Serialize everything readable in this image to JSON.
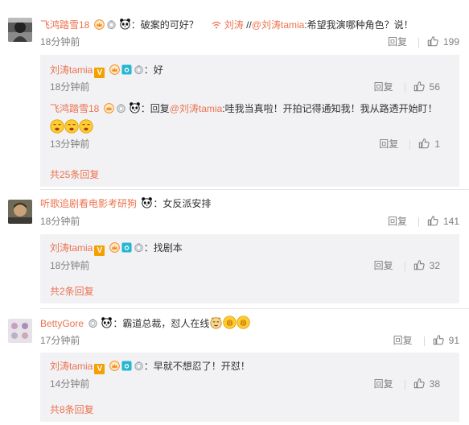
{
  "comments": [
    {
      "user": "飞鸿踏雪18",
      "colon": "：",
      "text_before_link": "破案的可好？",
      "repost_user": "刘涛",
      "text_mid": " //",
      "mention": "@刘涛tamia",
      "text_after": ":希望我演哪种角色？说！",
      "time": "18分钟前",
      "reply_label": "回复",
      "likes": "199",
      "replies": [
        {
          "user": "刘涛tamia",
          "colon": "：",
          "text": "好",
          "time": "18分钟前",
          "reply_label": "回复",
          "likes": "56"
        },
        {
          "user": "飞鸿踏雪18",
          "colon": "：",
          "reply_prefix": "回复",
          "mention": "@刘涛tamia",
          "text": ":哇我当真啦！开拍记得通知我！我从路透开始盯！",
          "time": "13分钟前",
          "reply_label": "回复",
          "likes": "1"
        }
      ],
      "more_label": "共25条回复"
    },
    {
      "user": "听歌追剧看电影考研狗",
      "colon": "：",
      "text": "女反派安排",
      "time": "18分钟前",
      "reply_label": "回复",
      "likes": "141",
      "replies": [
        {
          "user": "刘涛tamia",
          "colon": "：",
          "text": "找剧本",
          "time": "18分钟前",
          "reply_label": "回复",
          "likes": "32"
        }
      ],
      "more_label": "共2条回复"
    },
    {
      "user": "BettyGore",
      "colon": "：",
      "text": "霸道总裁，怼人在线",
      "time": "17分钟前",
      "reply_label": "回复",
      "likes": "91",
      "replies": [
        {
          "user": "刘涛tamia",
          "colon": "：",
          "text": "早就不想忍了！开怼！",
          "time": "14分钟前",
          "reply_label": "回复",
          "likes": "38"
        }
      ],
      "more_label": "共8条回复"
    }
  ],
  "colors": {
    "accent": "#eb7350",
    "subbg": "#f2f2f5",
    "muted": "#808080"
  },
  "icons": [
    "like-icon",
    "vip-v-badge",
    "panda-icon",
    "medal-icon",
    "camera-icon",
    "crown-icon"
  ]
}
